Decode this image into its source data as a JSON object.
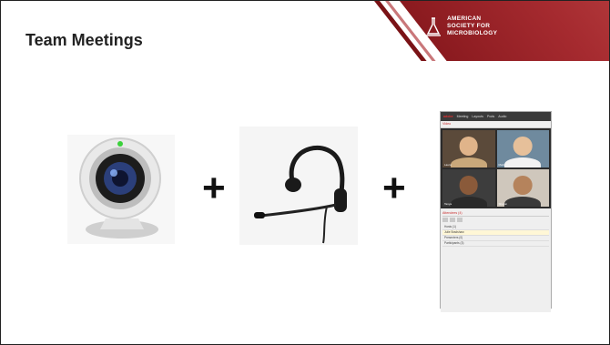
{
  "slide": {
    "title": "Team Meetings",
    "logo": {
      "line1": "AMERICAN",
      "line2": "SOCIETY FOR",
      "line3": "MICROBIOLOGY"
    },
    "plus1": "+",
    "plus2": "+"
  },
  "screen": {
    "menu": [
      "adobe",
      "Meeting",
      "Layouts",
      "Pods",
      "Audio"
    ],
    "video_label": "Video",
    "attendees_label": "Attendees (4)",
    "rows": [
      "Hosts (1)",
      "Julie Bradshaw",
      "Presenters (0)",
      "Participants (3)"
    ],
    "names": [
      "Laura",
      "Mark",
      "Tanya",
      "Sharon"
    ]
  },
  "colors": {
    "banner": "#a52a2f",
    "text": "#222222"
  }
}
